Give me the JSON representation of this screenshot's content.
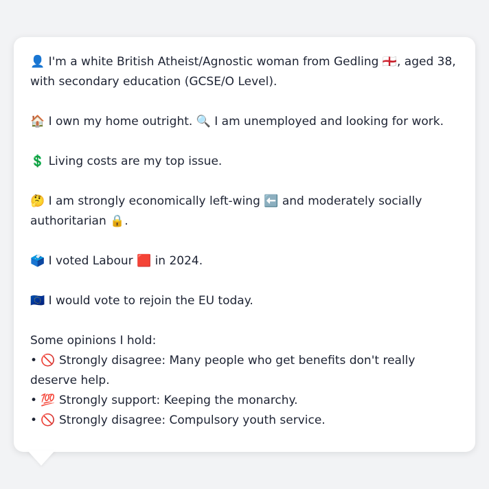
{
  "profile": {
    "line1": "👤 I'm a white British Atheist/Agnostic woman from Gedling 🏴󠁧󠁢󠁥󠁮󠁧󠁿, aged 38, with secondary education (GCSE/O Level).",
    "line2": "🏠 I own my home outright. 🔍 I am unemployed and looking for work.",
    "line3": "💲 Living costs are my top issue.",
    "line4": "🤔 I am strongly economically left-wing ⬅️ and moderately socially authoritarian 🔒.",
    "line5": "🗳️ I voted Labour 🟥 in 2024.",
    "line6": "🇪🇺 I would vote to rejoin the EU today."
  },
  "opinions": {
    "heading": "Some opinions I hold:",
    "items": [
      "• 🚫 Strongly disagree: Many people who get benefits don't really deserve help.",
      "• 💯 Strongly support: Keeping the monarchy.",
      "• 🚫 Strongly disagree: Compulsory youth service."
    ]
  }
}
